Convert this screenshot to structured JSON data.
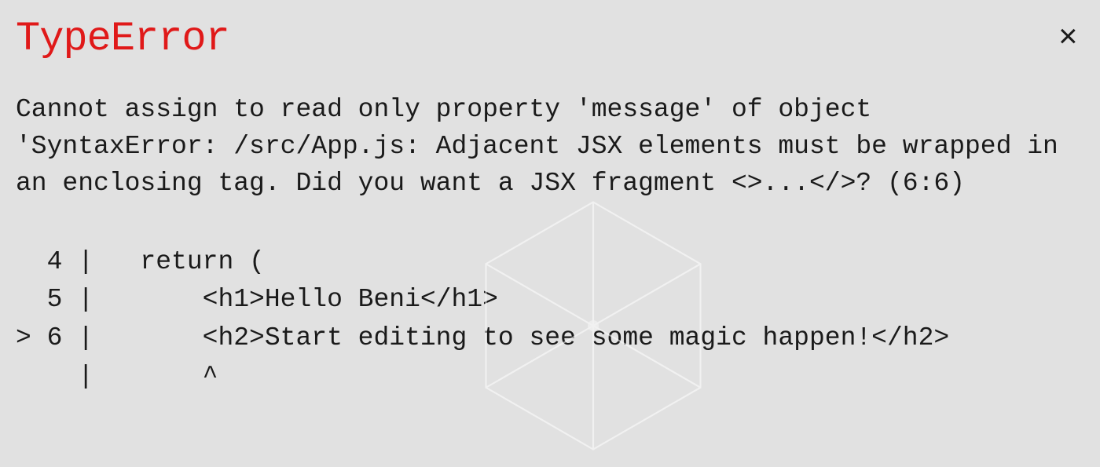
{
  "error": {
    "title": "TypeError",
    "description": "Cannot assign to read only property 'message' of object 'SyntaxError: /src/App.js: Adjacent JSX elements must be wrapped in an enclosing tag. Did you want a JSX fragment <>...</>? (6:6)"
  },
  "code": {
    "lines": [
      {
        "marker": " ",
        "number": "4",
        "content": "  return ("
      },
      {
        "marker": " ",
        "number": "5",
        "content": "      <h1>Hello Beni</h1>"
      },
      {
        "marker": ">",
        "number": "6",
        "content": "      <h2>Start editing to see some magic happen!</h2>"
      },
      {
        "marker": " ",
        "number": " ",
        "content": "      ^"
      }
    ]
  },
  "close_label": "×"
}
